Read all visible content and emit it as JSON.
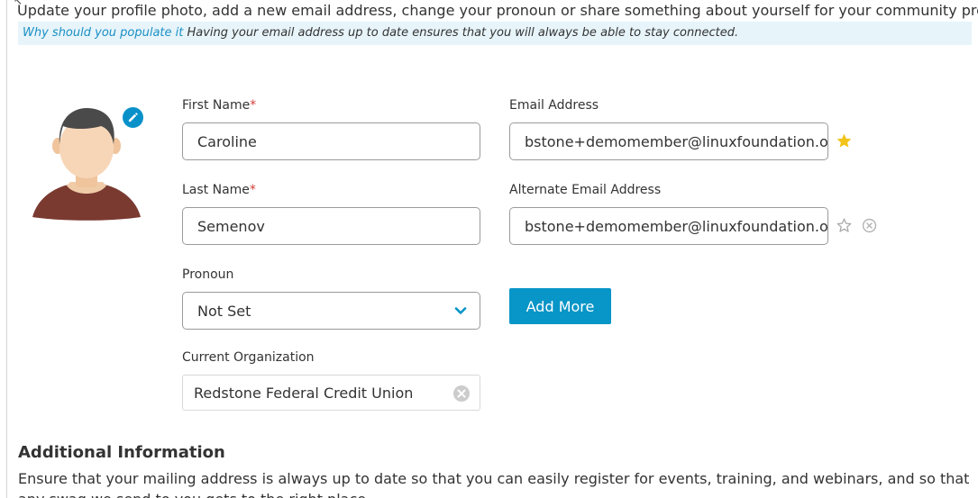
{
  "intro_text": "Update your profile photo, add a new email address, change your pronoun or share something about yourself for your community profile",
  "info_bar": {
    "why_link": "Why should you populate it",
    "message": "Having your email address up to date ensures that you will always be able to stay connected."
  },
  "form": {
    "first_name": {
      "label": "First Name",
      "required_mark": "*",
      "value": "Caroline"
    },
    "last_name": {
      "label": "Last Name",
      "required_mark": "*",
      "value": "Semenov"
    },
    "pronoun": {
      "label": "Pronoun",
      "value": "Not Set"
    },
    "organization": {
      "label": "Current Organization",
      "value": "Redstone Federal Credit Union"
    },
    "email": {
      "label": "Email Address",
      "value": "bstone+demomember@linuxfoundation.or"
    },
    "alt_email": {
      "label": "Alternate Email Address",
      "value": "bstone+demomember@linuxfoundation.or"
    },
    "add_more_label": "Add More"
  },
  "icons": {
    "edit": "pencil-icon",
    "primary_star": "star-filled-icon",
    "alt_star": "star-outline-icon",
    "remove": "close-circle-icon",
    "dropdown": "chevron-down-icon",
    "clear": "clear-icon"
  },
  "colors": {
    "accent": "#0895c7",
    "star": "#f2c318",
    "required": "#d43f3a",
    "info_bg": "#e7f4fa"
  },
  "additional": {
    "title": "Additional Information",
    "description": "Ensure that your mailing address is always up to date so that you can easily register for events, training, and webinars, and so that any swag we send to you gets to the right place."
  }
}
